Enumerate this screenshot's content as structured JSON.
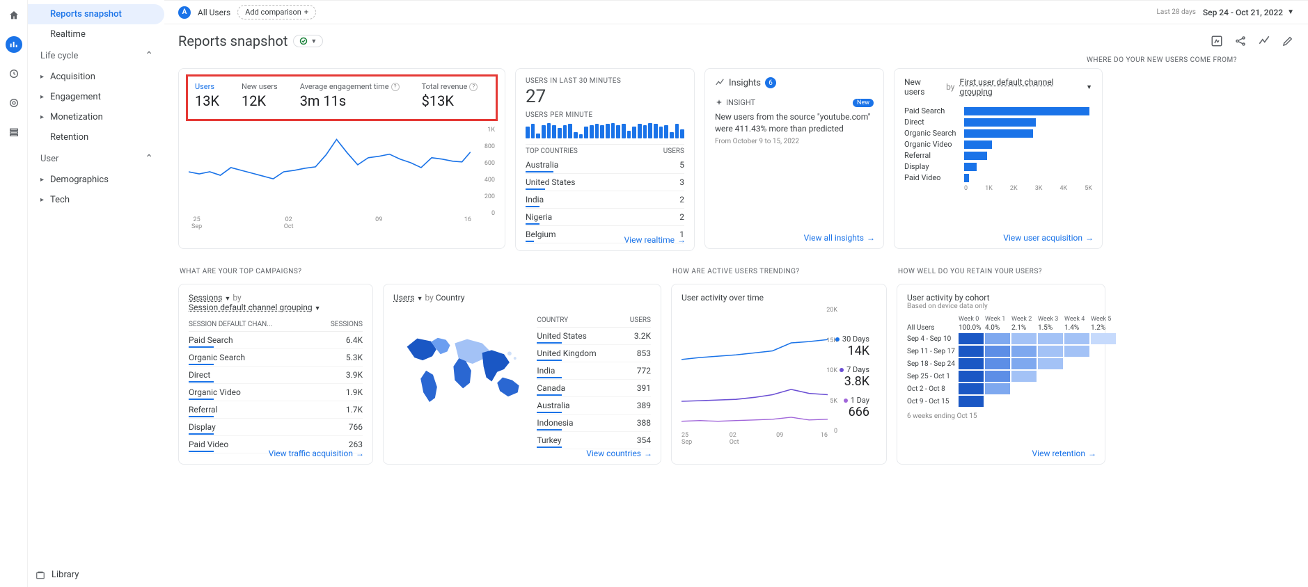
{
  "rail_icons": [
    "home",
    "reports",
    "explore",
    "advertising",
    "configure"
  ],
  "sidebar": {
    "items": [
      {
        "label": "Reports snapshot",
        "selected": true,
        "leaf": true
      },
      {
        "label": "Realtime",
        "leaf": true
      }
    ],
    "lifecycle": {
      "label": "Life cycle",
      "items": [
        "Acquisition",
        "Engagement",
        "Monetization",
        "Retention"
      ]
    },
    "user": {
      "label": "User",
      "items": [
        "Demographics",
        "Tech"
      ]
    },
    "library": "Library"
  },
  "topbar": {
    "all_users": "All Users",
    "add_comparison": "Add comparison",
    "date_label": "Last 28 days",
    "date_range": "Sep 24 - Oct 21, 2022"
  },
  "title": "Reports snapshot",
  "overview": {
    "metrics": [
      {
        "label": "Users",
        "value": "13K",
        "active": true
      },
      {
        "label": "New users",
        "value": "12K"
      },
      {
        "label": "Average engagement time",
        "value": "3m 11s",
        "help": true
      },
      {
        "label": "Total revenue",
        "value": "$13K",
        "help": true
      }
    ],
    "y_ticks": [
      "1K",
      "800",
      "600",
      "400",
      "200",
      "0"
    ],
    "x_ticks": [
      "25\nSep",
      "02\nOct",
      "09",
      "16"
    ]
  },
  "chart_data": {
    "overview_line": {
      "type": "line",
      "title": "Users",
      "ylim": [
        0,
        1000
      ],
      "x": [
        "Sep 24",
        "Sep 25",
        "Sep 26",
        "Sep 27",
        "Sep 28",
        "Sep 29",
        "Sep 30",
        "Oct 1",
        "Oct 2",
        "Oct 3",
        "Oct 4",
        "Oct 5",
        "Oct 6",
        "Oct 7",
        "Oct 8",
        "Oct 9",
        "Oct 10",
        "Oct 11",
        "Oct 12",
        "Oct 13",
        "Oct 14",
        "Oct 15",
        "Oct 16",
        "Oct 17",
        "Oct 18",
        "Oct 19",
        "Oct 20",
        "Oct 21"
      ],
      "values": [
        470,
        450,
        480,
        430,
        520,
        490,
        460,
        420,
        400,
        480,
        500,
        520,
        540,
        700,
        900,
        740,
        600,
        680,
        700,
        720,
        660,
        620,
        560,
        680,
        660,
        640,
        620,
        720
      ]
    },
    "users_per_minute": {
      "type": "bar",
      "title": "Users per minute",
      "ylim": [
        0,
        30
      ],
      "values": [
        18,
        22,
        8,
        20,
        24,
        20,
        16,
        20,
        22,
        10,
        6,
        18,
        20,
        22,
        20,
        22,
        24,
        20,
        22,
        12,
        18,
        22,
        20,
        24,
        22,
        18,
        20,
        10,
        22,
        14
      ]
    },
    "new_users_by_channel": {
      "type": "bar",
      "title": "New users by First user default channel grouping",
      "xlim": [
        0,
        5000
      ],
      "categories": [
        "Paid Search",
        "Direct",
        "Organic Search",
        "Organic Video",
        "Referral",
        "Display",
        "Paid Video"
      ],
      "values": [
        4900,
        2800,
        2700,
        1100,
        900,
        500,
        200
      ]
    },
    "user_activity": {
      "type": "line",
      "title": "User activity over time",
      "ylim": [
        0,
        20000
      ],
      "x": [
        "Sep 25",
        "Oct 2",
        "Oct 9",
        "Oct 16"
      ],
      "series": [
        {
          "name": "30 Days",
          "color": "#1a73e8",
          "values": [
            12500,
            12800,
            13200,
            14000
          ],
          "display": "14K"
        },
        {
          "name": "7 Days",
          "color": "#6b4fd4",
          "values": [
            3400,
            3500,
            3900,
            3800
          ],
          "display": "3.8K"
        },
        {
          "name": "1 Day",
          "color": "#a065d9",
          "values": [
            600,
            620,
            700,
            666
          ],
          "display": "666"
        }
      ]
    },
    "cohort": {
      "type": "heatmap",
      "title": "User activity by cohort",
      "columns": [
        "Week 0",
        "Week 1",
        "Week 2",
        "Week 3",
        "Week 4",
        "Week 5"
      ],
      "all_users": [
        "100.0%",
        "4.0%",
        "2.1%",
        "1.5%",
        "1.4%",
        "1.2%"
      ],
      "rows": [
        {
          "label": "Sep 4 - Sep 10",
          "cells": [
            100,
            70,
            60,
            60,
            60,
            50
          ]
        },
        {
          "label": "Sep 11 - Sep 17",
          "cells": [
            100,
            80,
            70,
            60,
            60,
            0
          ]
        },
        {
          "label": "Sep 18 - Sep 24",
          "cells": [
            100,
            80,
            70,
            60,
            0,
            0
          ]
        },
        {
          "label": "Sep 25 - Oct 1",
          "cells": [
            100,
            80,
            60,
            0,
            0,
            0
          ]
        },
        {
          "label": "Oct 2 - Oct 8",
          "cells": [
            100,
            70,
            0,
            0,
            0,
            0
          ]
        },
        {
          "label": "Oct 9 - Oct 15",
          "cells": [
            100,
            0,
            0,
            0,
            0,
            0
          ]
        }
      ],
      "footer": "6 weeks ending Oct 15"
    }
  },
  "realtime": {
    "title": "USERS IN LAST 30 MINUTES",
    "value": "27",
    "per_minute": "USERS PER MINUTE",
    "top_countries_label": "TOP COUNTRIES",
    "users_label": "USERS",
    "countries": [
      {
        "name": "Australia",
        "value": "5",
        "w": 40
      },
      {
        "name": "United States",
        "value": "3",
        "w": 28
      },
      {
        "name": "India",
        "value": "2",
        "w": 20
      },
      {
        "name": "Nigeria",
        "value": "2",
        "w": 20
      },
      {
        "name": "Belgium",
        "value": "1",
        "w": 12
      }
    ],
    "link": "View realtime"
  },
  "insights": {
    "title": "Insights",
    "count": "6",
    "label": "INSIGHT",
    "badge": "New",
    "text": "New users from the source \"youtube.com\" were 411.43% more than predicted",
    "date": "From October 9 to 15, 2022",
    "link": "View all insights"
  },
  "new_users": {
    "heading": "WHERE DO YOUR NEW USERS COME FROM?",
    "prefix": "New users",
    "by": "by",
    "dimension": "First user default channel grouping",
    "axis": [
      "0",
      "1K",
      "2K",
      "3K",
      "4K",
      "5K"
    ],
    "link": "View user acquisition"
  },
  "row2_headings": {
    "campaigns": "WHAT ARE YOUR TOP CAMPAIGNS?",
    "trending": "HOW ARE ACTIVE USERS TRENDING?",
    "retain": "HOW WELL DO YOU RETAIN YOUR USERS?"
  },
  "campaigns": {
    "metric": "Sessions",
    "by": "by",
    "dim": "Session default channel grouping",
    "col1": "SESSION DEFAULT CHAN...",
    "col2": "SESSIONS",
    "rows": [
      {
        "name": "Paid Search",
        "value": "6.4K"
      },
      {
        "name": "Organic Search",
        "value": "5.3K"
      },
      {
        "name": "Direct",
        "value": "3.9K"
      },
      {
        "name": "Organic Video",
        "value": "1.9K"
      },
      {
        "name": "Referral",
        "value": "1.7K"
      },
      {
        "name": "Display",
        "value": "766"
      },
      {
        "name": "Paid Video",
        "value": "263"
      }
    ],
    "link": "View traffic acquisition"
  },
  "countries": {
    "metric": "Users",
    "by": "by",
    "dim": "Country",
    "col1": "COUNTRY",
    "col2": "USERS",
    "rows": [
      {
        "name": "United States",
        "value": "3.2K"
      },
      {
        "name": "United Kingdom",
        "value": "853"
      },
      {
        "name": "India",
        "value": "772"
      },
      {
        "name": "Canada",
        "value": "391"
      },
      {
        "name": "Australia",
        "value": "389"
      },
      {
        "name": "Indonesia",
        "value": "388"
      },
      {
        "name": "Turkey",
        "value": "354"
      }
    ],
    "link": "View countries"
  },
  "activity": {
    "title": "User activity over time",
    "y_ticks": [
      "20K",
      "15K",
      "10K",
      "5K",
      "0"
    ],
    "x_ticks": [
      "25\nSep",
      "02\nOct",
      "09",
      "16"
    ]
  },
  "cohort": {
    "title": "User activity by cohort",
    "subtitle": "Based on device data only",
    "all_users_label": "All Users",
    "link": "View retention"
  }
}
